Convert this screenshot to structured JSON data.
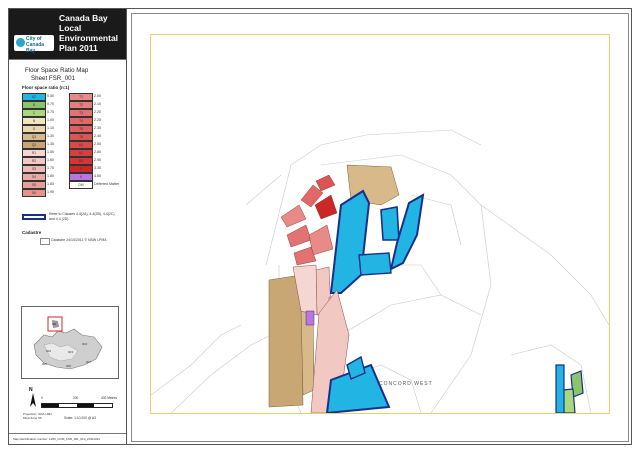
{
  "header": {
    "title_lines": [
      "Canada Bay Local",
      "Environmental",
      "Plan 2011"
    ],
    "logo_text": "City of Canada Bay"
  },
  "sheet": {
    "map_name": "Floor Space Ratio Map",
    "sheet_id": "Sheet FSR_001",
    "fsr_heading": "Floor space ratio (n:1)"
  },
  "legend_left": [
    {
      "code": "A2",
      "value": "0.50"
    },
    {
      "code": "B",
      "value": "0.70"
    },
    {
      "code": "C",
      "value": "0.75"
    },
    {
      "code": "N",
      "value": "1.00"
    },
    {
      "code": "O",
      "value": "1.10"
    },
    {
      "code": "Q1",
      "value": "1.30"
    },
    {
      "code": "Q2",
      "value": "1.35"
    },
    {
      "code": "R1",
      "value": "1.50"
    },
    {
      "code": "R2",
      "value": "1.60"
    },
    {
      "code": "S3",
      "value": "1.70"
    },
    {
      "code": "S4",
      "value": "1.80"
    },
    {
      "code": "S5",
      "value": "1.83"
    },
    {
      "code": "S6",
      "value": "1.90"
    }
  ],
  "legend_right": [
    {
      "code": "T1",
      "value": "2.00"
    },
    {
      "code": "T2",
      "value": "2.10"
    },
    {
      "code": "T3",
      "value": "2.20"
    },
    {
      "code": "T4",
      "value": "2.25"
    },
    {
      "code": "T5",
      "value": "2.30"
    },
    {
      "code": "T6",
      "value": "2.40"
    },
    {
      "code": "U1",
      "value": "2.50"
    },
    {
      "code": "U2",
      "value": "2.80"
    },
    {
      "code": "U3",
      "value": "2.90"
    },
    {
      "code": "V",
      "value": "3.30"
    },
    {
      "code": "X",
      "value": "4.50"
    },
    {
      "code": "DM",
      "value": "Deferred Matter"
    }
  ],
  "legend_colors": {
    "left": [
      "#22b5e3",
      "#8cc46a",
      "#a8d87e",
      "#f2e4bf",
      "#e9d7ad",
      "#d7b98a",
      "#c9a775",
      "#f6d6d2",
      "#f2c8c2",
      "#efbab5",
      "#eaaaa5",
      "#e89d98",
      "#e6938d"
    ],
    "right": [
      "#e88a88",
      "#e67e7e",
      "#e37272",
      "#e26868",
      "#df5e5e",
      "#dc5555",
      "#d94a4a",
      "#d63f3f",
      "#d43535",
      "#cc2727",
      "#b877e0",
      "#ffffff"
    ]
  },
  "refer_note": "Refer to Clauses 4.4(2A), 4.4(2B), 4.4(2C) and 4.4 (2D).",
  "cadastre": {
    "heading": "Cadastre",
    "item": "Cadastre 24/10/2011 © NSW LPMA"
  },
  "scale": {
    "north": "N",
    "ticks": [
      "0",
      "200",
      "400  Metres"
    ],
    "ratio": "Scale: 1:10,000 @ A3",
    "projection": "Projection: GDA 1994 MGA Zone 56"
  },
  "footer": "Map identification number: 1250_COM_FSR_001_010_20111024",
  "locmap_labels": [
    "001",
    "002",
    "003",
    "004",
    "005",
    "006",
    "007"
  ],
  "map_labels": {
    "street_a": "CONCORD WEST",
    "street_b": "M"
  },
  "colors": {
    "blue": "#22b5e3",
    "blue_border": "#1a2f8c",
    "tan": "#c9a775",
    "red": "#d94a4a",
    "pink": "#f2c8c2",
    "purple": "#b877e0",
    "green": "#8cc46a"
  }
}
